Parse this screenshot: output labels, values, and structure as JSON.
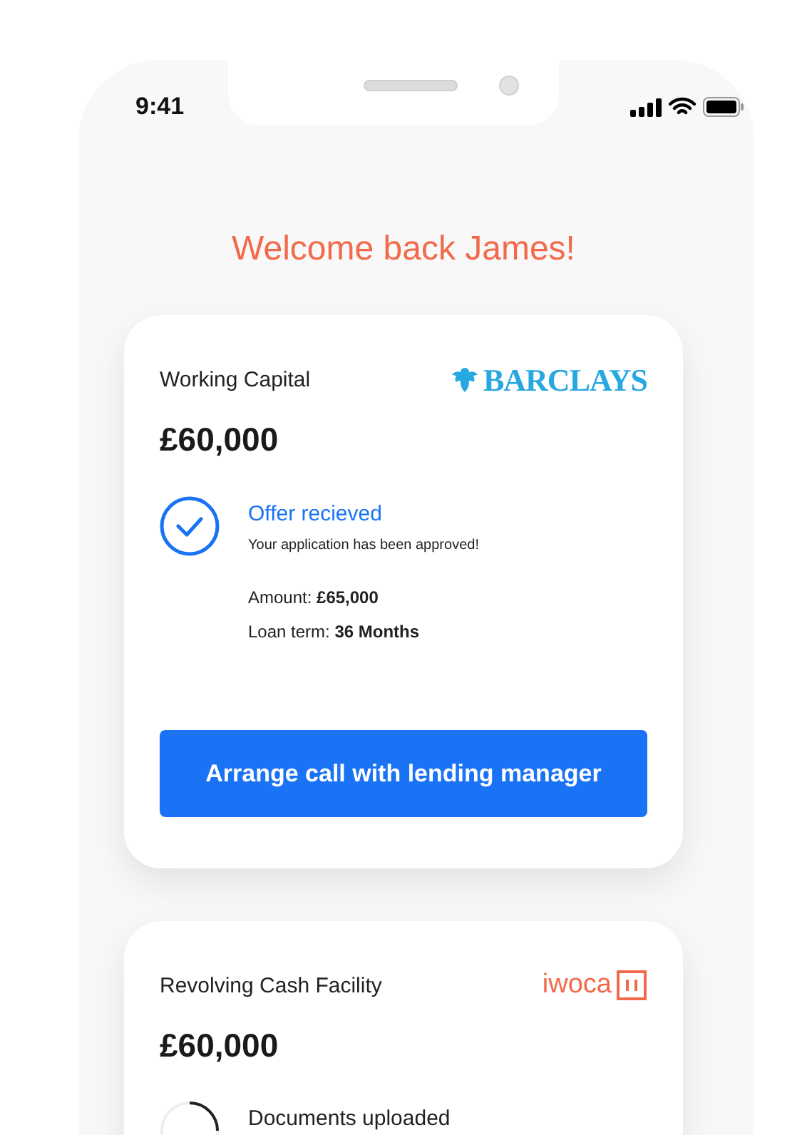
{
  "status_bar": {
    "time": "9:41"
  },
  "greeting": "Welcome back James!",
  "loans": [
    {
      "product": "Working Capital",
      "amount": "£60,000",
      "lender": {
        "kind": "barclays",
        "name": "BARCLAYS"
      },
      "status": {
        "kind": "done",
        "title": "Offer recieved",
        "message": "Your application has been approved!"
      },
      "details": [
        "Amount: **£65,000**",
        "Loan term: **36 Months**"
      ],
      "action": "Arrange call with lending manager"
    },
    {
      "product": "Revolving Cash Facility",
      "amount": "£60,000",
      "lender": {
        "kind": "iwoca",
        "name": "iwoca"
      },
      "status": {
        "kind": "pending",
        "title": "Documents uploaded"
      }
    }
  ]
}
